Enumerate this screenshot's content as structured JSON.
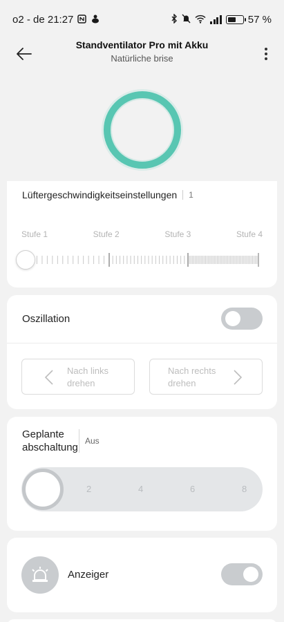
{
  "status_bar": {
    "carrier_time": "o2 - de 21:27",
    "battery": "57 %"
  },
  "header": {
    "title": "Standventilator Pro mit Akku",
    "subtitle": "Natürliche brise"
  },
  "speed": {
    "title": "Lüftergeschwindigkeitseinstellungen",
    "value": "1",
    "levels": [
      "Stufe 1",
      "Stufe 2",
      "Stufe 3",
      "Stufe 4"
    ],
    "slider_level": 1
  },
  "oscillation": {
    "label": "Oszillation",
    "enabled": false,
    "left_button": "Nach links drehen",
    "right_button": "Nach rechts drehen"
  },
  "timer": {
    "label": "Geplante abschaltung",
    "value": "Aus",
    "ticks": [
      "2",
      "4",
      "6",
      "8"
    ]
  },
  "indicator": {
    "label": "Anzeiger",
    "enabled": true
  },
  "colors": {
    "accent": "#58c6b2",
    "toggle_bg": "#c9cccf"
  },
  "icons": [
    "back-arrow-icon",
    "more-icon",
    "bluetooth-icon",
    "mute-icon",
    "wifi-icon",
    "signal-icon",
    "battery-icon",
    "nfc-icon",
    "alarm-light-icon",
    "chevron-left-icon",
    "chevron-right-icon"
  ]
}
